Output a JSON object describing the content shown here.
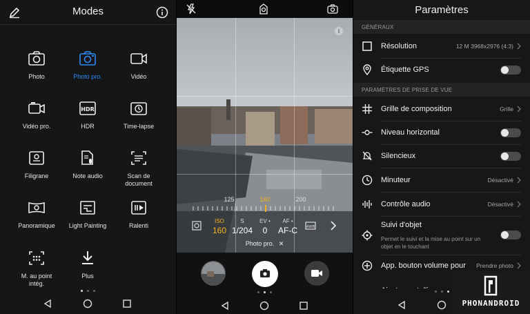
{
  "modes_screen": {
    "title": "Modes",
    "modes": [
      {
        "label": "Photo",
        "icon": "camera-icon"
      },
      {
        "label": "Photo pro.",
        "icon": "camera-pro-icon"
      },
      {
        "label": "Vidéo",
        "icon": "video-icon"
      },
      {
        "label": "Vidéo pro.",
        "icon": "video-pro-icon"
      },
      {
        "label": "HDR",
        "icon": "hdr-icon"
      },
      {
        "label": "Time-lapse",
        "icon": "timelapse-icon"
      },
      {
        "label": "Filigrane",
        "icon": "watermark-icon"
      },
      {
        "label": "Note audio",
        "icon": "audio-note-icon"
      },
      {
        "label": "Scan de\ndocument",
        "icon": "document-scan-icon"
      },
      {
        "label": "Panoramique",
        "icon": "panorama-icon"
      },
      {
        "label": "Light Painting",
        "icon": "light-painting-icon"
      },
      {
        "label": "Ralenti",
        "icon": "slow-motion-icon"
      },
      {
        "label": "M. au point\nintég.",
        "icon": "all-focus-icon"
      },
      {
        "label": "Plus",
        "icon": "download-icon"
      }
    ],
    "active_mode": "Photo pro."
  },
  "camera_screen": {
    "scale_numbers": [
      "125",
      "160",
      "200"
    ],
    "params": [
      {
        "label": "ISO",
        "value": "160",
        "highlight": true
      },
      {
        "label": "S",
        "value": "1/204",
        "highlight": false
      },
      {
        "label": "EV •",
        "value": "0",
        "highlight": false
      },
      {
        "label": "AF •",
        "value": "AF-C",
        "highlight": false
      }
    ],
    "mode_tag": "Photo pro.",
    "mode_tag_close": "✕"
  },
  "settings_screen": {
    "title": "Paramètres",
    "section_general": "GÉNÉRAUX",
    "section_capture": "PARAMÈTRES DE PRISE DE VUE",
    "resolution": {
      "label": "Résolution",
      "value": "12 M 3968x2976 (4:3)"
    },
    "gps": {
      "label": "Étiquette GPS",
      "on": false
    },
    "grid": {
      "label": "Grille de composition",
      "value": "Grille"
    },
    "level": {
      "label": "Niveau horizontal",
      "on": false
    },
    "silent": {
      "label": "Silencieux",
      "on": false
    },
    "timer": {
      "label": "Minuteur",
      "value": "Désactivé"
    },
    "audio": {
      "label": "Contrôle audio",
      "value": "Désactivé"
    },
    "tracking": {
      "label": "Suivi d'objet",
      "desc": "Permet le suivi et la mise au point sur un objet en le touchant",
      "on": false
    },
    "volume": {
      "label": "App. bouton volume pour",
      "value": "Prendre photo"
    },
    "adjust": {
      "label": "Ajustement d'image"
    }
  },
  "watermark": {
    "text": "PHONANDROID"
  },
  "colors": {
    "accent": "#2f8bf3",
    "highlight": "#f2b320"
  }
}
